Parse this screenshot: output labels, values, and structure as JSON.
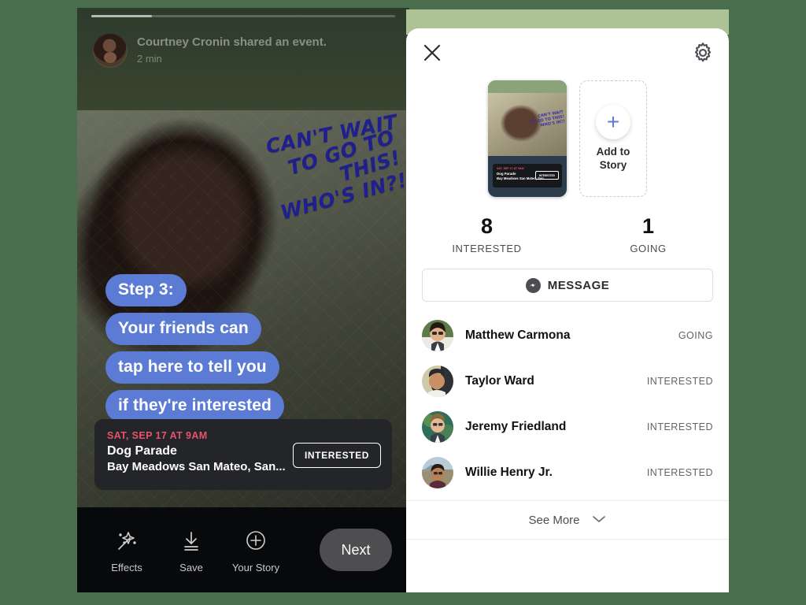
{
  "theme": {
    "page_background": "#4a6e4b",
    "band_green": "#adc396",
    "bubble_blue": "#5b7bd5",
    "accent_red": "#e4546a",
    "handwriting_blue": "#1f1f8e"
  },
  "story_panel": {
    "poster": {
      "name": "Courtney Cronin shared an event.",
      "time": "2 min",
      "avatar_icon": "user-avatar"
    },
    "handwriting": [
      "CAN'T WAIT",
      "TO GO TO THIS!",
      "WHO'S IN?!"
    ],
    "steps": [
      "Step 3:",
      "Your friends can",
      "tap here to tell you",
      "if they're interested"
    ],
    "arrow_icon": "curved-down-arrow-icon",
    "event_card": {
      "date": "SAT, SEP 17 AT 9AM",
      "title": "Dog Parade",
      "location": "Bay Meadows San Mateo, San...",
      "cta_label": "INTERESTED"
    },
    "toolbar": {
      "items": [
        {
          "label": "Effects",
          "icon": "magic-wand-icon"
        },
        {
          "label": "Save",
          "icon": "download-icon"
        },
        {
          "label": "Your Story",
          "icon": "plus-circle-icon"
        }
      ],
      "next_label": "Next"
    }
  },
  "detail_panel": {
    "close_icon": "close-icon",
    "settings_icon": "gear-icon",
    "story_thumb": {
      "date": "SAT, SEP 17 AT 9AM",
      "title": "Dog Parade",
      "location": "Bay Meadows San Mateo, San...",
      "pill": "INTERESTED",
      "tag": [
        "CAN'T WAIT",
        "TO GO TO THIS!",
        "WHO'S IN?!"
      ]
    },
    "add_to_story": {
      "label": "Add to\nStory",
      "line1": "Add to",
      "line2": "Story",
      "icon": "plus-icon"
    },
    "stats": [
      {
        "number": "8",
        "label": "INTERESTED"
      },
      {
        "number": "1",
        "label": "GOING"
      }
    ],
    "message_button": {
      "label": "MESSAGE",
      "icon": "messenger-icon"
    },
    "people": [
      {
        "name": "Matthew Carmona",
        "status": "GOING",
        "avatar_icon": "user-avatar"
      },
      {
        "name": "Taylor Ward",
        "status": "INTERESTED",
        "avatar_icon": "user-avatar"
      },
      {
        "name": "Jeremy Friedland",
        "status": "INTERESTED",
        "avatar_icon": "user-avatar"
      },
      {
        "name": "Willie Henry Jr.",
        "status": "INTERESTED",
        "avatar_icon": "user-avatar"
      }
    ],
    "see_more": {
      "label": "See More",
      "icon": "chevron-down-icon"
    }
  }
}
